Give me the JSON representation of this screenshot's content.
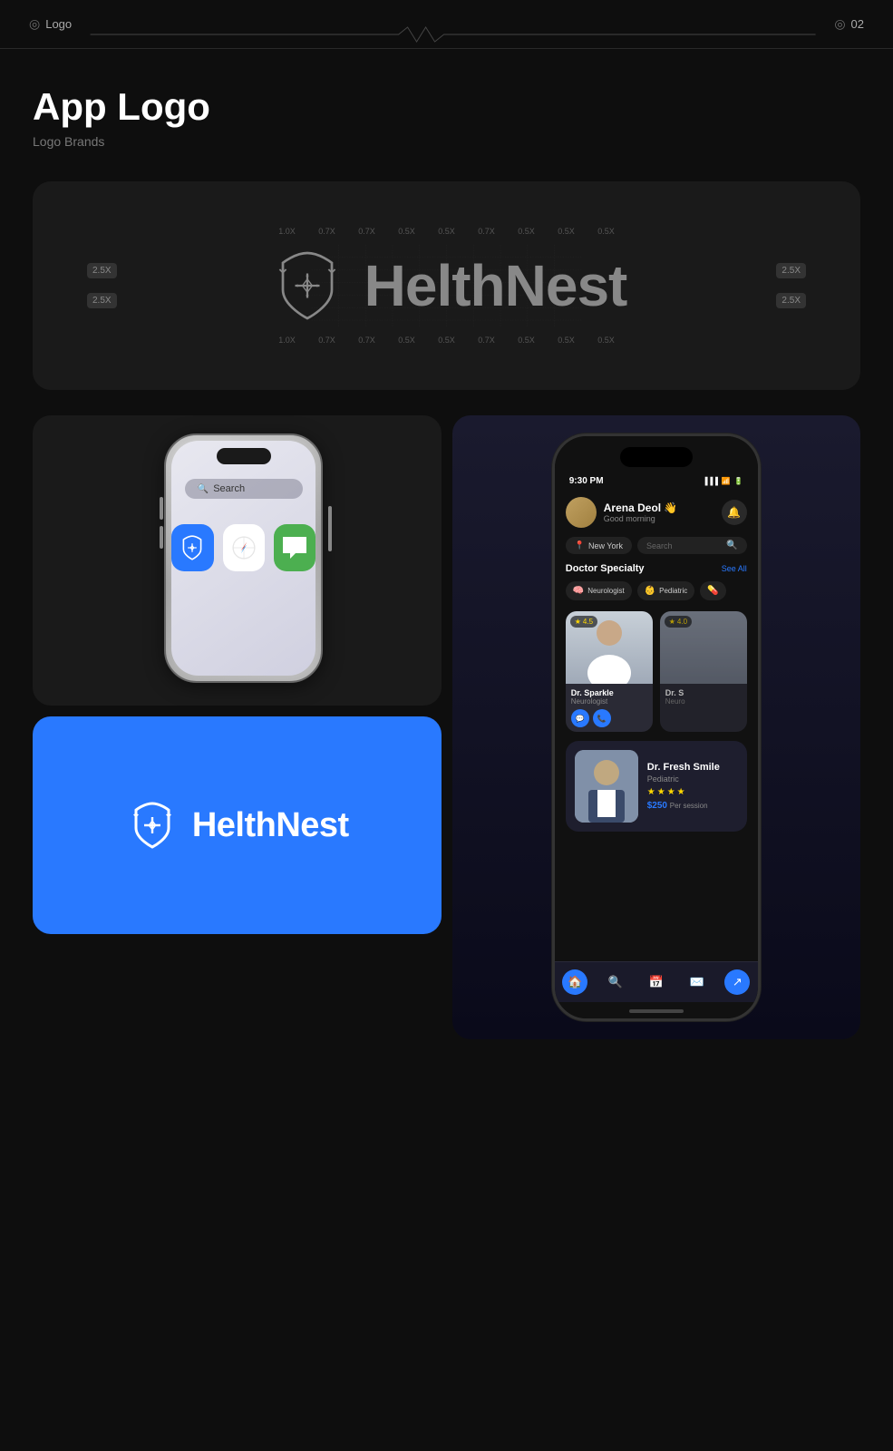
{
  "header": {
    "logo_label": "Logo",
    "page_num": "02",
    "eye_icon": "👁",
    "eye_icon2": "👁"
  },
  "page": {
    "title": "App Logo",
    "subtitle": "Logo Brands"
  },
  "logo_grid": {
    "corner_tl": "2.5X",
    "corner_tr": "2.5X",
    "corner_bl": "2.5X",
    "corner_br": "2.5X",
    "scale_top": [
      "1.0X",
      "0.7X",
      "0.7X",
      "0.5X",
      "0.5X",
      "0.7X",
      "0.5X",
      "0.5X",
      "0.5X"
    ],
    "scale_bottom": [
      "1.0X",
      "0.7X",
      "0.7X",
      "0.5X",
      "0.5X",
      "0.7X",
      "0.5X",
      "0.5X",
      "0.5X"
    ],
    "brand_name": "HelthNest"
  },
  "phone_home": {
    "search_placeholder": "Search",
    "app1_name": "HelthNest",
    "app2_name": "Safari",
    "app3_name": "Messages"
  },
  "blue_brand": {
    "brand_name": "HelthNest"
  },
  "app_screen": {
    "status_time": "9:30 PM",
    "user_name": "Arena Deol 👋",
    "user_greeting": "Good morning",
    "location": "New York",
    "search_placeholder": "Search",
    "section_title": "Doctor Specialty",
    "see_all": "See All",
    "specialty1": "Neurologist",
    "specialty2": "Pediatric",
    "doctor1_name": "Dr. Sparkle",
    "doctor1_specialty": "Neurologist",
    "doctor1_rating": "4.5",
    "doctor2_name": "Dr. S",
    "doctor2_specialty": "Neuro",
    "featured_name": "Dr. Fresh Smile",
    "featured_specialty": "Pediatric",
    "featured_price": "$250",
    "featured_price_label": "Per session",
    "stars": [
      "★",
      "★",
      "★",
      "★"
    ],
    "nav_icons": [
      "🏠",
      "🔍",
      "📅",
      "✉",
      "↗"
    ]
  }
}
